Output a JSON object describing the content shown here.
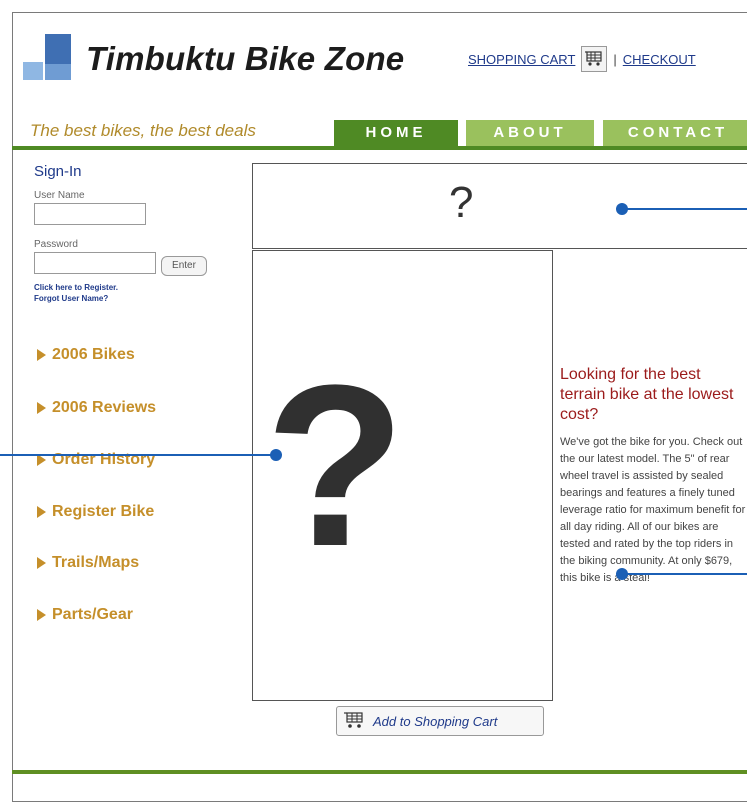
{
  "site": {
    "name": "Timbuktu Bike Zone",
    "tagline": "The best bikes, the best deals"
  },
  "topnav": {
    "shopping_cart": "SHOPPING CART",
    "separator": "|",
    "checkout": "CHECKOUT"
  },
  "tabs": [
    {
      "label": "HOME"
    },
    {
      "label": "ABOUT"
    },
    {
      "label": "CONTACT"
    }
  ],
  "signin": {
    "title": "Sign-In",
    "username_label": "User Name",
    "username_value": "",
    "password_label": "Password",
    "password_value": "",
    "enter_label": "Enter",
    "register_link": "Click here to Register.",
    "forgot_link": "Forgot User Name?"
  },
  "sidebar": {
    "items": [
      {
        "label": "2006 Bikes"
      },
      {
        "label": "2006 Reviews"
      },
      {
        "label": "Order History"
      },
      {
        "label": "Register Bike"
      },
      {
        "label": "Trails/Maps"
      },
      {
        "label": "Parts/Gear"
      }
    ]
  },
  "placeholders": {
    "top_symbol": "?",
    "main_symbol": "?"
  },
  "promo": {
    "title": "Looking for the best terrain bike at the lowest cost?",
    "body": "We've got the bike for you. Check out the our latest model. The 5\" of rear wheel travel is assisted by sealed bearings and features a finely tuned leverage ratio for maximum benefit for all day riding. All of our bikes are tested and rated by the top riders in the biking community. At only $679, this bike is a steal!"
  },
  "cart_button": {
    "label": "Add to Shopping Cart"
  },
  "colors": {
    "tab_active": "#4f8a24",
    "tab_inactive": "#9ac15d",
    "callout": "#1b5fb5",
    "accent_gold": "#c58f2a",
    "promo_title": "#9b1b1b"
  }
}
